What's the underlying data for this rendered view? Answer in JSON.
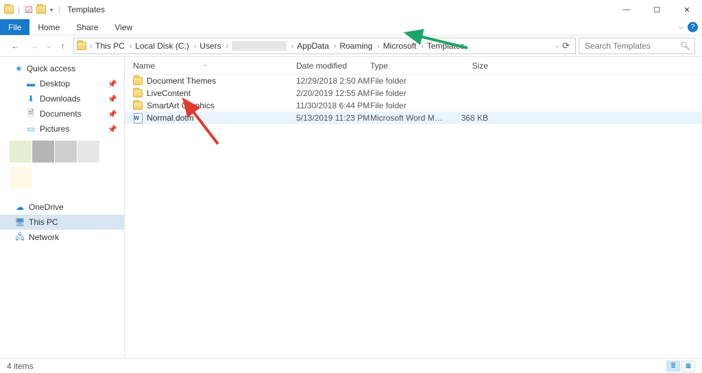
{
  "window": {
    "title": "Templates"
  },
  "ribbon": {
    "tabs": [
      "File",
      "Home",
      "Share",
      "View"
    ]
  },
  "breadcrumbs": [
    "This PC",
    "Local Disk (C:)",
    "Users",
    "",
    "AppData",
    "Roaming",
    "Microsoft",
    "Templates"
  ],
  "search": {
    "placeholder": "Search Templates"
  },
  "sidebar": {
    "quick": "Quick access",
    "items": [
      {
        "label": "Desktop",
        "pinned": true,
        "icon": "desktop"
      },
      {
        "label": "Downloads",
        "pinned": true,
        "icon": "download"
      },
      {
        "label": "Documents",
        "pinned": true,
        "icon": "doc"
      },
      {
        "label": "Pictures",
        "pinned": true,
        "icon": "pic"
      }
    ],
    "onedrive": "OneDrive",
    "thispc": "This PC",
    "network": "Network"
  },
  "columns": {
    "name": "Name",
    "date": "Date modified",
    "type": "Type",
    "size": "Size"
  },
  "rows": [
    {
      "name": "Document Themes",
      "date": "12/29/2018 2:50 AM",
      "type": "File folder",
      "size": "",
      "icon": "folder"
    },
    {
      "name": "LiveContent",
      "date": "2/20/2019 12:55 AM",
      "type": "File folder",
      "size": "",
      "icon": "folder"
    },
    {
      "name": "SmartArt Graphics",
      "date": "11/30/2018 6:44 PM",
      "type": "File folder",
      "size": "",
      "icon": "folder"
    },
    {
      "name": "Normal.dotm",
      "date": "5/13/2019 11:23 PM",
      "type": "Microsoft Word Macr...",
      "size": "368 KB",
      "icon": "word"
    }
  ],
  "status": {
    "count": "4 items"
  },
  "swatches": [
    "#e6efd0",
    "#b6b6b6",
    "#cfcfcf",
    "#e6e6e6"
  ]
}
